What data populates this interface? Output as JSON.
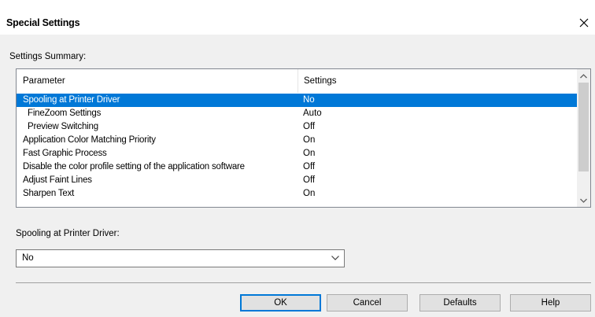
{
  "window": {
    "title": "Special Settings",
    "close_icon": "close-icon"
  },
  "summary": {
    "label": "Settings Summary:",
    "columns": [
      "Parameter",
      "Settings"
    ],
    "rows": [
      {
        "parameter": "Spooling at Printer Driver",
        "setting": "No",
        "selected": true,
        "indent": false
      },
      {
        "parameter": "FineZoom Settings",
        "setting": "Auto",
        "selected": false,
        "indent": true
      },
      {
        "parameter": "Preview Switching",
        "setting": "Off",
        "selected": false,
        "indent": true
      },
      {
        "parameter": "Application Color Matching Priority",
        "setting": "On",
        "selected": false,
        "indent": false
      },
      {
        "parameter": "Fast Graphic Process",
        "setting": "On",
        "selected": false,
        "indent": false
      },
      {
        "parameter": "Disable the color profile setting of the application software",
        "setting": "Off",
        "selected": false,
        "indent": false
      },
      {
        "parameter": "Adjust Faint Lines",
        "setting": "Off",
        "selected": false,
        "indent": false
      },
      {
        "parameter": "Sharpen Text",
        "setting": "On",
        "selected": false,
        "indent": false
      }
    ]
  },
  "driver": {
    "label": "Spooling at Printer Driver:",
    "value": "No"
  },
  "buttons": {
    "ok": "OK",
    "cancel": "Cancel",
    "defaults": "Defaults",
    "help": "Help"
  },
  "colors": {
    "selection": "#0078d7",
    "dialog_bg": "#f0f0f0"
  }
}
